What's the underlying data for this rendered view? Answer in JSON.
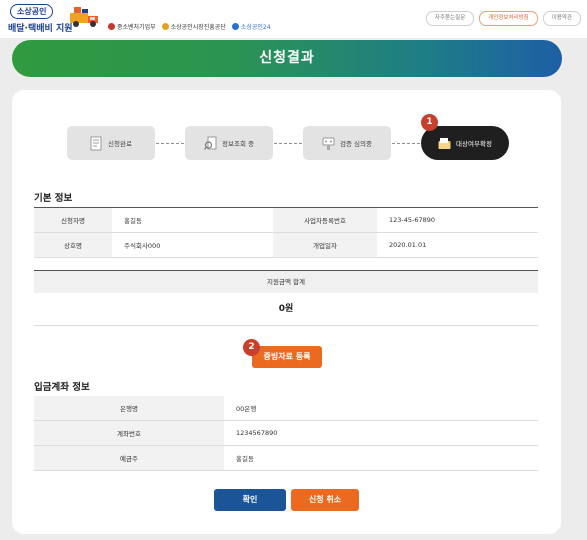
{
  "header": {
    "logo_pill": "소상공인",
    "logo_sub": "배달·택배비 지원",
    "orgs": [
      {
        "label": "중소벤처기업부",
        "color": "#c53a2e"
      },
      {
        "label": "소상공인시장진흥공단",
        "color": "#e3a020"
      },
      {
        "label": "소상공인24",
        "color": "#2a6fd0"
      }
    ],
    "links": [
      "자주묻는질문",
      "개인정보처리방침",
      "이용약관"
    ]
  },
  "banner": {
    "title": "신청결과"
  },
  "steps": [
    {
      "label": "신청완료",
      "icon": "document-icon",
      "state": "done"
    },
    {
      "label": "정보조회 중",
      "icon": "search-doc-icon",
      "state": "done"
    },
    {
      "label": "검증 심의중",
      "icon": "review-icon",
      "state": "done"
    },
    {
      "label": "대상여부확정",
      "icon": "folder-icon",
      "state": "active"
    }
  ],
  "badges": [
    "1",
    "2"
  ],
  "basic_info": {
    "title": "기본 정보",
    "rows": [
      [
        {
          "label": "신청자명",
          "value": "홍길동"
        },
        {
          "label": "사업자등록번호",
          "value": "123-45-67890"
        }
      ],
      [
        {
          "label": "상호명",
          "value": "주식회사000"
        },
        {
          "label": "개업일자",
          "value": "2020.01.01"
        }
      ]
    ]
  },
  "total": {
    "label": "지원금액 합계",
    "value": "0원"
  },
  "evidence_button": "증빙자료 등록",
  "deposit": {
    "title": "입금계좌 정보",
    "rows": [
      {
        "label": "은행명",
        "value": "00은행"
      },
      {
        "label": "계좌번호",
        "value": "1234567890"
      },
      {
        "label": "예금주",
        "value": "홍길동"
      }
    ]
  },
  "actions": {
    "confirm": "확인",
    "cancel": "신청 취소"
  },
  "colors": {
    "accent_orange": "#ec6a1f",
    "confirm_blue": "#1b5597",
    "badge_red": "#c6402b"
  }
}
